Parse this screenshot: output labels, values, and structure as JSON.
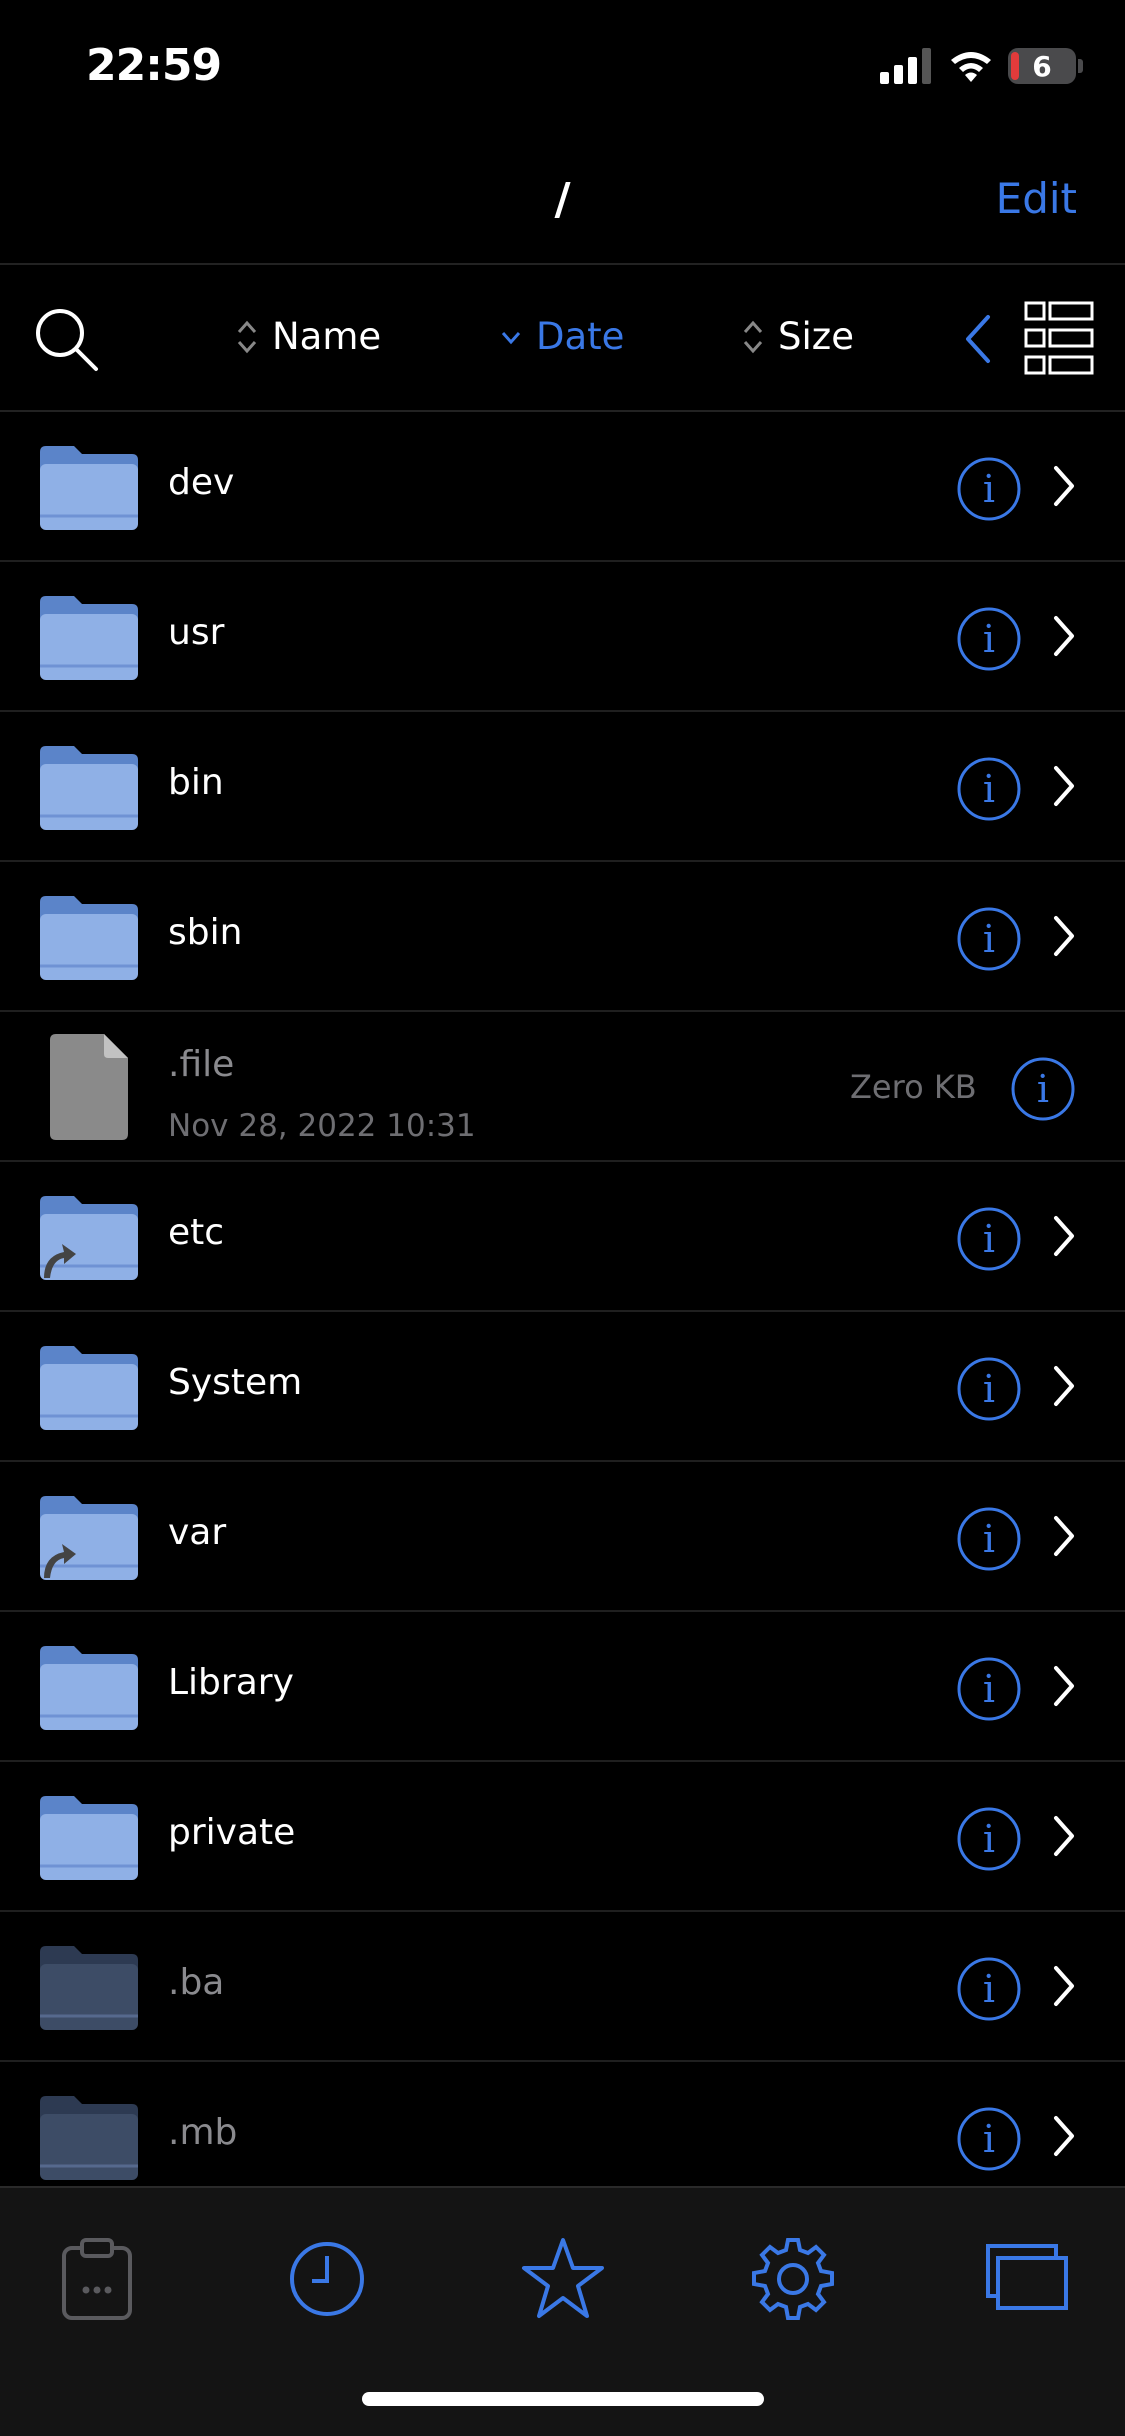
{
  "status": {
    "time": "22:59",
    "battery": "6"
  },
  "nav": {
    "title": "/",
    "edit_label": "Edit"
  },
  "sort": {
    "name_label": "Name",
    "date_label": "Date",
    "size_label": "Size"
  },
  "items": [
    {
      "name": "dev",
      "kind": "folder"
    },
    {
      "name": "usr",
      "kind": "folder"
    },
    {
      "name": "bin",
      "kind": "folder"
    },
    {
      "name": "sbin",
      "kind": "folder"
    },
    {
      "name": ".file",
      "kind": "file",
      "date": "Nov 28, 2022 10:31",
      "size": "Zero KB"
    },
    {
      "name": "etc",
      "kind": "folder-alias"
    },
    {
      "name": "System",
      "kind": "folder"
    },
    {
      "name": "var",
      "kind": "folder-alias"
    },
    {
      "name": "Library",
      "kind": "folder"
    },
    {
      "name": "private",
      "kind": "folder"
    },
    {
      "name": ".ba",
      "kind": "folder-hidden"
    },
    {
      "name": ".mb",
      "kind": "folder-hidden"
    }
  ],
  "tabs": [
    {
      "icon": "clipboard-icon"
    },
    {
      "icon": "clock-icon"
    },
    {
      "icon": "star-icon"
    },
    {
      "icon": "gear-icon"
    },
    {
      "icon": "windows-icon"
    }
  ],
  "colors": {
    "accent": "#3a78e6",
    "folder": "#8fb0e6",
    "folder_tab": "#5b84c9",
    "background": "#000000"
  }
}
